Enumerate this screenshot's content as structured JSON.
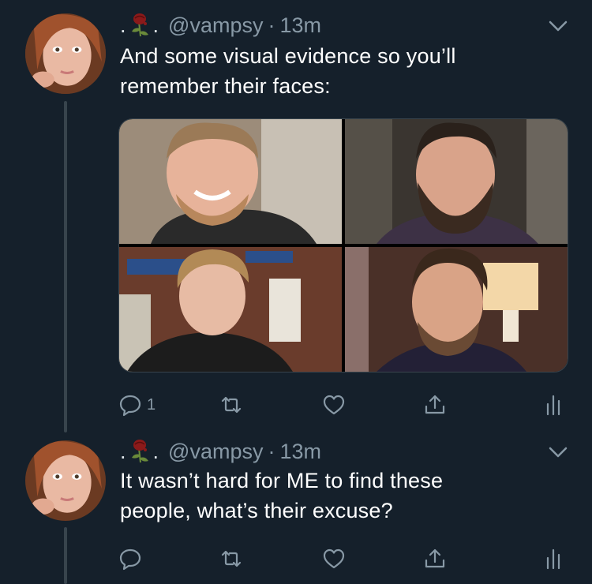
{
  "tweets": [
    {
      "emoji_dot_left": ".",
      "emoji_dot_right": ".",
      "handle": "@vampsy",
      "separator": "·",
      "time": "13m",
      "text_line1": "And some visual evidence so you’ll",
      "text_line2": "remember their faces:",
      "reply_count": "1",
      "media_count": 4
    },
    {
      "emoji_dot_left": ".",
      "emoji_dot_right": ".",
      "handle": "@vampsy",
      "separator": "·",
      "time": "13m",
      "text_line1": "It wasn’t hard for ME to find these",
      "text_line2": "people, what’s their excuse?",
      "reply_count": ""
    }
  ],
  "icons": [
    "rose-icon",
    "chevron-down-icon",
    "reply-icon",
    "retweet-icon",
    "like-icon",
    "share-icon",
    "analytics-icon"
  ],
  "colors": {
    "background": "#15202b",
    "secondary_text": "#8899a6",
    "thread_line": "#38444d"
  }
}
